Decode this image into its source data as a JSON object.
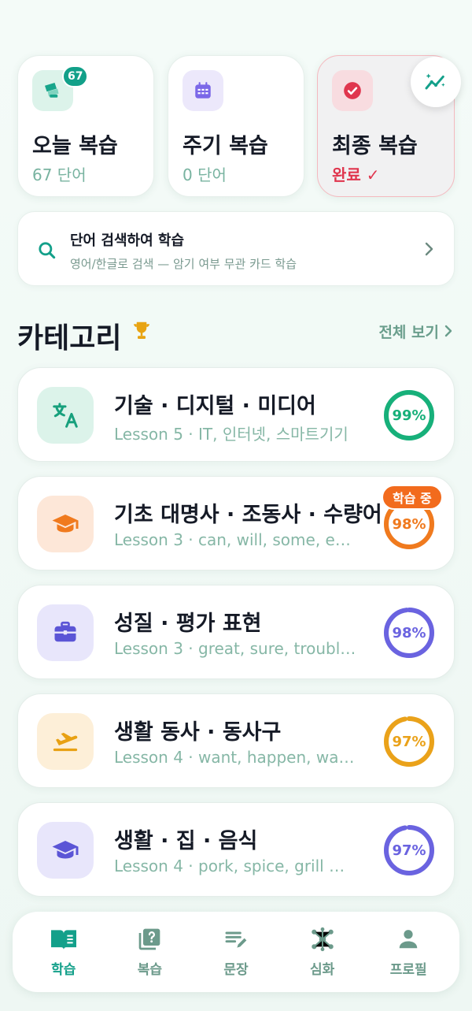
{
  "review": {
    "today": {
      "title": "오늘 복습",
      "sub": "67 단어",
      "badge": "67"
    },
    "periodic": {
      "title": "주기 복습",
      "sub": "0 단어"
    },
    "final": {
      "title": "최종 복습",
      "sub": "완료 ✓"
    }
  },
  "search": {
    "title": "단어 검색하여 학습",
    "sub": "영어/한글로 검색 — 암기 여부 무관 카드 학습"
  },
  "categories_header": {
    "title": "카테고리",
    "see_all": "전체 보기"
  },
  "categories": [
    {
      "title": "기술 · 디지털 · 미디어",
      "sub": "Lesson 5 · IT, 인터넷, 스마트기기",
      "percent": "99%",
      "progress": 0.99,
      "color": "#17b07a",
      "bg": "#dcf3ea",
      "icon": "translate-icon"
    },
    {
      "title": "기초 대명사 · 조동사 · 수량어",
      "sub": "Lesson 3 · can, will, some, e…",
      "percent": "98%",
      "progress": 0.98,
      "color": "#f07a1e",
      "bg": "#fde7d8",
      "icon": "graduation-cap-icon",
      "badge": "학습 중"
    },
    {
      "title": "성질 · 평가 표현",
      "sub": "Lesson 3 · great, sure, troubl…",
      "percent": "98%",
      "progress": 0.98,
      "color": "#6a63e0",
      "bg": "#e8e6fb",
      "icon": "briefcase-icon"
    },
    {
      "title": "생활 동사 · 동사구",
      "sub": "Lesson 4 · want, happen, wa…",
      "percent": "97%",
      "progress": 0.97,
      "color": "#eaa21a",
      "bg": "#fdefd8",
      "icon": "flight-takeoff-icon"
    },
    {
      "title": "생활 · 집 · 음식",
      "sub": "Lesson 4 · pork, spice, grill …",
      "percent": "97%",
      "progress": 0.97,
      "color": "#6a63e0",
      "bg": "#e8e6fb",
      "icon": "graduation-cap-icon"
    }
  ],
  "nav": [
    {
      "label": "학습",
      "icon": "book-icon",
      "active": true
    },
    {
      "label": "복습",
      "icon": "quiz-icon"
    },
    {
      "label": "문장",
      "icon": "edit-note-icon"
    },
    {
      "label": "심화",
      "icon": "network-icon"
    },
    {
      "label": "프로필",
      "icon": "person-icon"
    }
  ]
}
